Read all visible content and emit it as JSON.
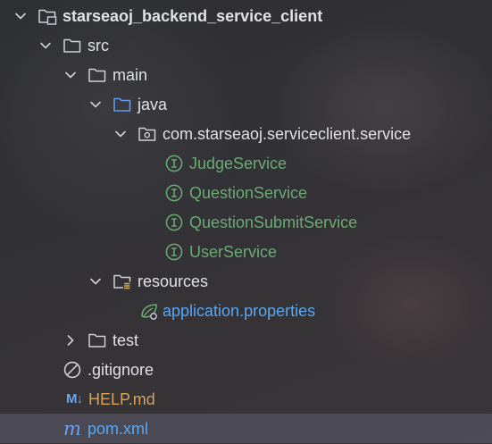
{
  "colors": {
    "background": "#2b2d30",
    "text": "#dfe1e5",
    "interface_green": "#6aab73",
    "properties_blue": "#56a8f5",
    "markdown_orange": "#d5a35d",
    "selection": "#4a4b5a"
  },
  "tree": {
    "root": {
      "label": "starseaoj_backend_service_client",
      "icon": "module-folder-icon"
    },
    "src": {
      "label": "src",
      "icon": "folder-icon"
    },
    "main": {
      "label": "main",
      "icon": "folder-icon"
    },
    "java": {
      "label": "java",
      "icon": "source-folder-icon"
    },
    "package": {
      "label": "com.starseaoj.serviceclient.service",
      "icon": "package-icon"
    },
    "interfaces": [
      {
        "label": "JudgeService",
        "icon": "interface-icon"
      },
      {
        "label": "QuestionService",
        "icon": "interface-icon"
      },
      {
        "label": "QuestionSubmitService",
        "icon": "interface-icon"
      },
      {
        "label": "UserService",
        "icon": "interface-icon"
      }
    ],
    "resources": {
      "label": "resources",
      "icon": "resources-folder-icon"
    },
    "properties": {
      "label": "application.properties",
      "icon": "spring-leaf-icon"
    },
    "test": {
      "label": "test",
      "icon": "folder-icon"
    },
    "gitignore": {
      "label": ".gitignore",
      "icon": "ignore-icon"
    },
    "help": {
      "label": "HELP.md",
      "icon_text": "M↓"
    },
    "pom": {
      "label": "pom.xml",
      "icon_text": "m"
    }
  }
}
